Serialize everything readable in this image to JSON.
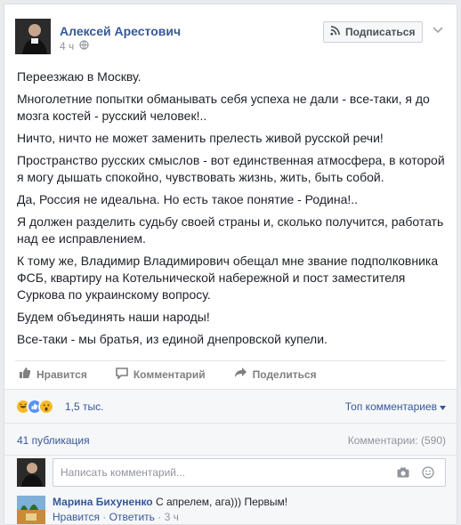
{
  "post": {
    "author": "Алексей Арестович",
    "time": "4 ч",
    "subscribe_label": "Подписаться",
    "paragraphs": [
      "Переезжаю в Москву.",
      "Многолетние попытки обманывать себя успеха не дали - все-таки, я до мозга костей - русский человек!..",
      "Ничто, ничто не может заменить прелесть живой русской речи!",
      "Пространство русских смыслов - вот единственная атмосфера, в которой я могу дышать спокойно, чувствовать жизнь, жить, быть собой.",
      "Да, Россия не идеальна. Но есть такое понятие - Родина!..",
      "Я должен разделить судьбу своей страны и, сколько получится, работать над ее исправлением.",
      "К тому же, Владимир Владимирович обещал мне звание подполковника ФСБ, квартиру на Котельнической набережной и пост заместителя Суркова по украинскому вопросу.",
      "Будем объединять наши народы!",
      "Все-таки - мы братья, из единой днепровской купели."
    ]
  },
  "actions": {
    "like": "Нравится",
    "comment": "Комментарий",
    "share": "Поделиться"
  },
  "reactions": {
    "count": "1,5 тыс.",
    "top_comments": "Топ комментариев"
  },
  "stats": {
    "shares": "41 публикация",
    "comments": "Комментарии: (590)"
  },
  "composer": {
    "placeholder": "Написать комментарий..."
  },
  "comment": {
    "author": "Марина Бихуненко",
    "text": "С апрелем, ага))) Первым!",
    "like": "Нравится",
    "separator": "·",
    "reply": "Ответить",
    "time": "3 ч"
  },
  "colors": {
    "link": "#365899",
    "muted": "#90949c",
    "like_blue": "#5890ff",
    "haha_yellow": "#f7b928"
  }
}
